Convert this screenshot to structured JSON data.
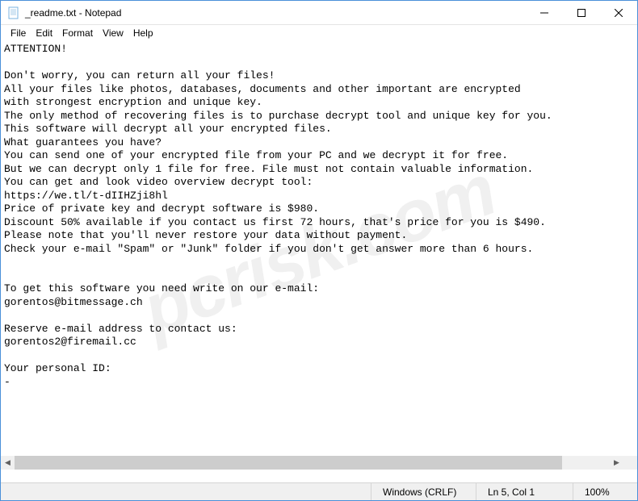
{
  "window": {
    "title": "_readme.txt - Notepad"
  },
  "menu": {
    "file": "File",
    "edit": "Edit",
    "format": "Format",
    "view": "View",
    "help": "Help"
  },
  "content": {
    "text": "ATTENTION!\n\nDon't worry, you can return all your files!\nAll your files like photos, databases, documents and other important are encrypted\nwith strongest encryption and unique key.\nThe only method of recovering files is to purchase decrypt tool and unique key for you.\nThis software will decrypt all your encrypted files.\nWhat guarantees you have?\nYou can send one of your encrypted file from your PC and we decrypt it for free.\nBut we can decrypt only 1 file for free. File must not contain valuable information.\nYou can get and look video overview decrypt tool:\nhttps://we.tl/t-dIIHZji8hl\nPrice of private key and decrypt software is $980.\nDiscount 50% available if you contact us first 72 hours, that's price for you is $490.\nPlease note that you'll never restore your data without payment.\nCheck your e-mail \"Spam\" or \"Junk\" folder if you don't get answer more than 6 hours.\n\n\nTo get this software you need write on our e-mail:\ngorentos@bitmessage.ch\n\nReserve e-mail address to contact us:\ngorentos2@firemail.cc\n\nYour personal ID:\n-"
  },
  "status": {
    "encoding": "Windows (CRLF)",
    "cursor": "Ln 5, Col 1",
    "zoom": "100%"
  },
  "watermark": "pcrisk.com"
}
